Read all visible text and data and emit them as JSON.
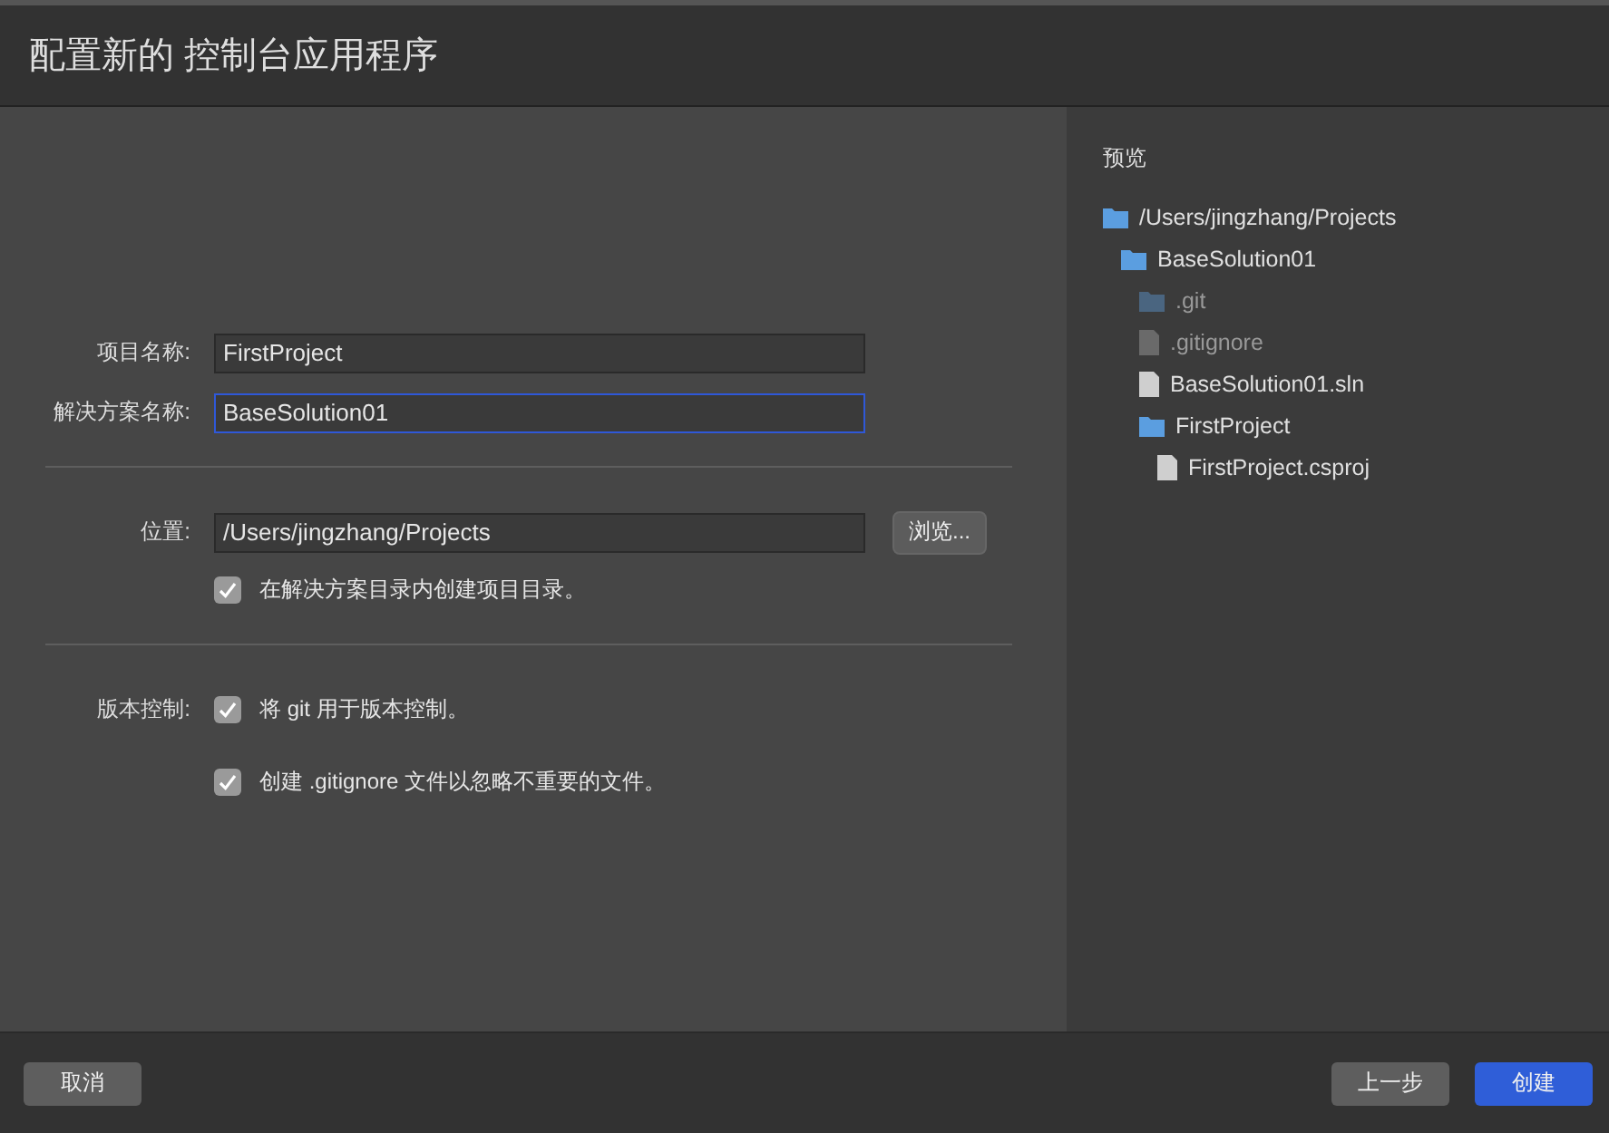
{
  "header": {
    "title": "配置新的 控制台应用程序"
  },
  "form": {
    "fields": [
      {
        "label": "项目名称:",
        "value": "FirstProject",
        "focused": false
      },
      {
        "label": "解决方案名称:",
        "value": "BaseSolution01",
        "focused": true
      }
    ],
    "location": {
      "label": "位置:",
      "value": "/Users/jingzhang/Projects",
      "browse_button": "浏览...",
      "checkbox": {
        "label": "在解决方案目录内创建项目目录。",
        "checked": true
      }
    },
    "version_control": {
      "label": "版本控制:",
      "checkboxes": [
        {
          "label": "将 git 用于版本控制。",
          "checked": true
        },
        {
          "label": "创建 .gitignore 文件以忽略不重要的文件。",
          "checked": true
        }
      ]
    }
  },
  "preview": {
    "title": "预览",
    "tree": [
      {
        "kind": "folder",
        "name": "/Users/jingzhang/Projects",
        "dimmed": false,
        "children": [
          {
            "kind": "folder",
            "name": "BaseSolution01",
            "dimmed": false,
            "children": [
              {
                "kind": "folder",
                "name": ".git",
                "dimmed": true
              },
              {
                "kind": "file",
                "name": ".gitignore",
                "dimmed": true
              },
              {
                "kind": "file",
                "name": "BaseSolution01.sln",
                "dimmed": false
              },
              {
                "kind": "folder",
                "name": "FirstProject",
                "dimmed": false,
                "children": [
                  {
                    "kind": "file",
                    "name": "FirstProject.csproj",
                    "dimmed": false
                  }
                ]
              }
            ]
          }
        ]
      }
    ]
  },
  "footer": {
    "buttons": [
      {
        "label": "取消",
        "kind": "secondary"
      },
      {
        "label": "上一步",
        "kind": "secondary"
      },
      {
        "label": "创建",
        "kind": "primary"
      }
    ]
  }
}
